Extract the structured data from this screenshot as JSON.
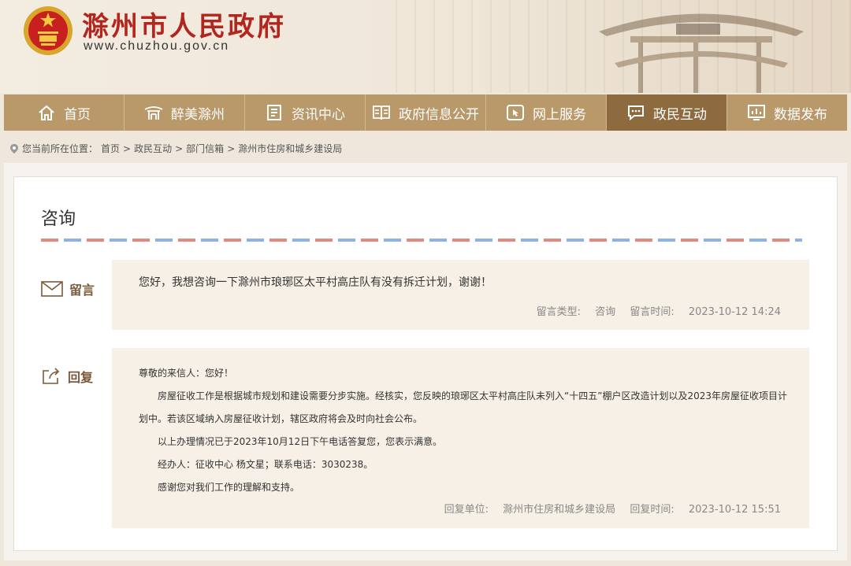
{
  "header": {
    "title": "滁州市人民政府",
    "url": "www.chuzhou.gov.cn"
  },
  "nav": [
    {
      "label": "首页",
      "icon": "home-icon"
    },
    {
      "label": "醉美滁州",
      "icon": "pavilion-icon"
    },
    {
      "label": "资讯中心",
      "icon": "document-icon"
    },
    {
      "label": "政府信息公开",
      "icon": "book-icon"
    },
    {
      "label": "网上服务",
      "icon": "cursor-icon"
    },
    {
      "label": "政民互动",
      "icon": "chat-icon",
      "active": true
    },
    {
      "label": "数据发布",
      "icon": "chart-icon"
    }
  ],
  "breadcrumb": {
    "prefix": "您当前所在位置：",
    "items": [
      "首页",
      "政民互动",
      "部门信箱",
      "滁州市住房和城乡建设局"
    ]
  },
  "page": {
    "title": "咨询"
  },
  "message": {
    "label": "留言",
    "text": "您好，我想咨询一下滁州市琅琊区太平村高庄队有没有拆迁计划，谢谢！",
    "type_label": "留言类型:",
    "type_value": "咨询",
    "time_label": "留言时间:",
    "time_value": "2023-10-12 14:24"
  },
  "reply": {
    "label": "回复",
    "greeting": "尊敬的来信人：您好！",
    "paragraphs": [
      "房屋征收工作是根据城市规划和建设需要分步实施。经核实，您反映的琅琊区太平村高庄队未列入“十四五”棚户区改造计划以及2023年房屋征收项目计划中。若该区域纳入房屋征收计划，辖区政府将会及时向社会公布。",
      "以上办理情况已于2023年10月12日下午电话答复您，您表示满意。",
      "经办人：征收中心 杨文星；联系电话：3030238。",
      "感谢您对我们工作的理解和支持。"
    ],
    "unit_label": "回复单位:",
    "unit_value": "滁州市住房和城乡建设局",
    "time_label": "回复时间:",
    "time_value": "2023-10-12 15:51"
  },
  "colors": {
    "nav_bg": "#b9986a",
    "nav_active": "#8e6b3f",
    "title_red": "#b3261e",
    "block_bg": "#f6f0e6"
  }
}
